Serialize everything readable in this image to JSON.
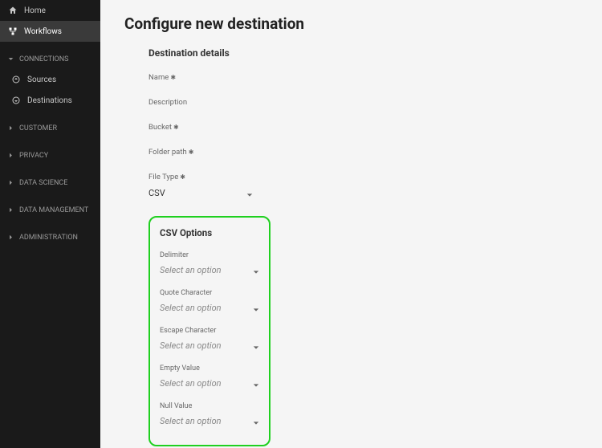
{
  "sidebar": {
    "home": "Home",
    "workflows": "Workflows",
    "sections": {
      "connections": {
        "label": "CONNECTIONS",
        "sources": "Sources",
        "destinations": "Destinations"
      },
      "customer": "CUSTOMER",
      "privacy": "PRIVACY",
      "dataScience": "DATA SCIENCE",
      "dataManagement": "DATA MANAGEMENT",
      "administration": "ADMINISTRATION"
    }
  },
  "page": {
    "title": "Configure new destination"
  },
  "details": {
    "heading": "Destination details",
    "nameLabel": "Name",
    "descriptionLabel": "Description",
    "bucketLabel": "Bucket",
    "folderPathLabel": "Folder path",
    "fileTypeLabel": "File Type",
    "fileTypeValue": "CSV"
  },
  "csv": {
    "heading": "CSV Options",
    "placeholder": "Select an option",
    "delimiterLabel": "Delimiter",
    "quoteLabel": "Quote Character",
    "escapeLabel": "Escape Character",
    "emptyLabel": "Empty Value",
    "nullLabel": "Null Value"
  }
}
